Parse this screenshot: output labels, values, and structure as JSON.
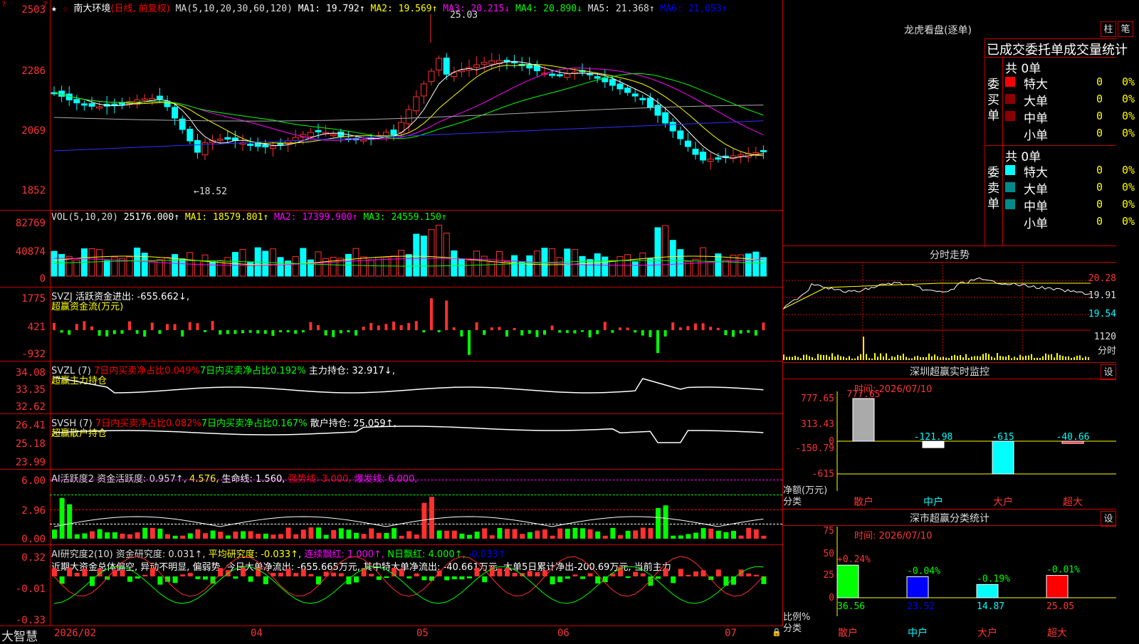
{
  "stock": {
    "name": "南大环境",
    "period": "(日线, 前复权)",
    "ma_label": "MA(5,10,20,30,60,120)",
    "ma1": "MA1: 19.792↑",
    "ma2": "MA2: 19.569↑",
    "ma3": "MA3: 20.215↓",
    "ma4": "MA4: 20.890↓",
    "ma5": "MA5: 21.368↑",
    "ma6": "MA6: 21.053↑",
    "high_mark": "25.03",
    "low_mark": "←18.52"
  },
  "price_axis": [
    "2503",
    "2286",
    "2069",
    "1852"
  ],
  "vol": {
    "label": "VOL(5,10,20)",
    "value": "25176.000↑",
    "ma1": "MA1: 18579.801↑",
    "ma2": "MA2: 17399.900↑",
    "ma3": "MA3: 24559.150↑",
    "axis": [
      "82769",
      "40874",
      "0"
    ]
  },
  "svzj": {
    "label": "SVZJ",
    "text": "活跃资金进出: -655.662↓,",
    "sub": "超赢资金流(万元)",
    "axis": [
      "1775",
      "421",
      "-932"
    ]
  },
  "svzl": {
    "label": "SVZL (7)",
    "t1": "7日内买卖净占比0.049%",
    "t2": "7日内买卖净占比0.192%",
    "t3": "主力持仓: 32.917↓,",
    "sub": "超赢主力持仓",
    "axis": [
      "34.08",
      "33.35",
      "32.62"
    ]
  },
  "svsh": {
    "label": "SVSH (7)",
    "t1": "7日内买卖净占比0.082%",
    "t2": "7日内买卖净占比0.167%",
    "t3": "散户持仓: 25.059↑,",
    "sub": "超赢散户持仓",
    "axis": [
      "26.41",
      "25.18",
      "23.99"
    ]
  },
  "ai1": {
    "label": "AI活跃度2 资金活跃度: 0.957↑,",
    "v2": "4.576,",
    "v3": "生命线: 1.560,",
    "v4": "强势线: 3.000,",
    "v5": "爆发线: 6.000,",
    "axis": [
      "6.00",
      "2.96",
      "0.00"
    ]
  },
  "ai2": {
    "label": "AI研究度2(10) 资金研究度: 0.031↑,",
    "v2": "平均研究度: -0.033↑,",
    "v3": "连续飘红: 1.000↑,",
    "v4": "N日飘红: 4.000↑,",
    "v5": "-0.033↑",
    "desc": "近期大资金总体偏空, 异动不明显, 偏弱势, 今日大单净流出: -655.665万元, 其中特大单净流出: -40.661万元, 大单5日累计净出-200.69万元, 当前主力",
    "axis": [
      "0.32",
      "-0.01",
      "-0.33"
    ]
  },
  "dates": {
    "brand": "大智慧",
    "d1": "2026/02",
    "d2": "04",
    "d3": "05",
    "d4": "06",
    "d5": "07"
  },
  "longhu": {
    "title": "龙虎看盘(逐单)",
    "btn1": "柱",
    "btn2": "笔",
    "header": "已成交委托单成交量统计",
    "buy_label": "委买单",
    "sell_label": "委卖单",
    "buy_total": "共 0单",
    "sell_total": "共 0单",
    "rows": [
      "特大",
      "大单",
      "中单",
      "小单"
    ],
    "zero": "0",
    "pct": "0%",
    "buy_colors": [
      "#ff0000",
      "#8b0000",
      "#8b0000",
      "#000000"
    ],
    "sell_colors": [
      "#00ffff",
      "#008b8b",
      "#008b8b",
      "#000000"
    ]
  },
  "intraday": {
    "title": "分时走势",
    "p1": "20.28",
    "p2": "19.91",
    "p3": "19.54",
    "v1": "1120",
    "v2": "分时"
  },
  "monitor": {
    "title": "深圳超赢实时监控",
    "btn": "设",
    "time": "时间: 2026/07/10",
    "axis": [
      "777.65",
      "313.43",
      "0",
      "-150.79",
      "-615"
    ],
    "ylabel": "净额(万元)",
    "xlabel": "分类",
    "cats": [
      "散户",
      "中户",
      "大户",
      "超大"
    ],
    "vals": [
      "777.65",
      "-121.98",
      "-615",
      "-40.66"
    ],
    "values": [
      777.65,
      -121.98,
      -615,
      -40.66
    ]
  },
  "classify": {
    "title": "深市超赢分类统计",
    "btn": "设",
    "time": "时间: 2026/07/10",
    "axis": [
      "75",
      "50",
      "25",
      "0"
    ],
    "ylabel": "比例%",
    "xlabel": "分类",
    "cats": [
      "散户",
      "中户",
      "大户",
      "超大"
    ],
    "changes": [
      "+0.24%",
      "-0.04%",
      "-0.19%",
      "-0.01%"
    ],
    "vals": [
      "36.56",
      "23.52",
      "14.87",
      "25.05"
    ],
    "values": [
      36.56,
      23.52,
      14.87,
      25.05
    ],
    "colors": [
      "#00ff00",
      "#0000ff",
      "#00ffff",
      "#ff0000"
    ]
  }
}
